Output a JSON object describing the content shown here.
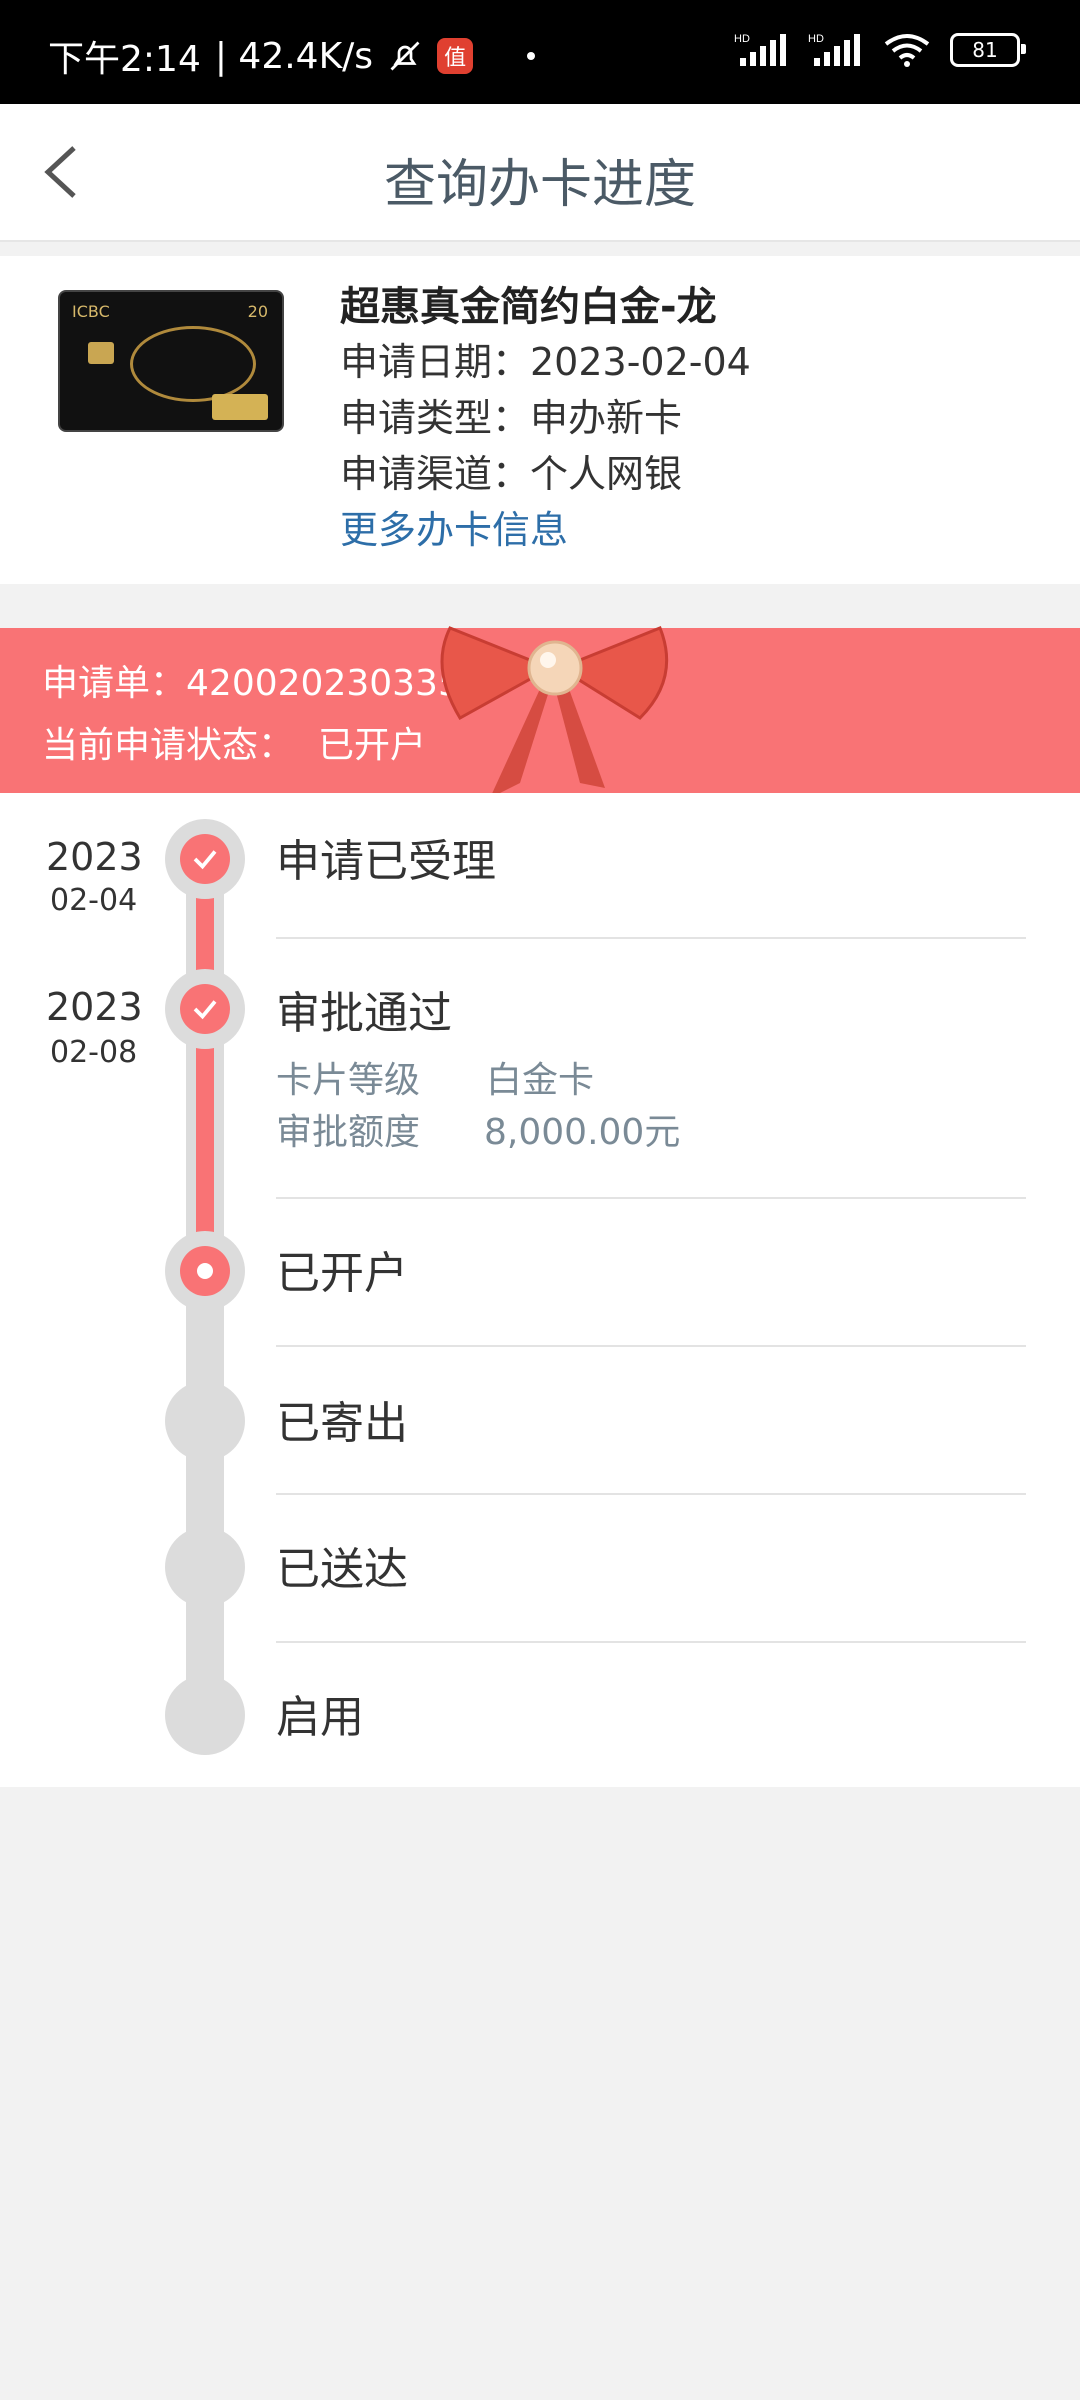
{
  "status_bar": {
    "time": "下午2:14",
    "speed": "| 42.4K/s",
    "app_badge": "值",
    "signal1": "HD",
    "signal2": "HD",
    "battery": "81"
  },
  "header": {
    "title": "查询办卡进度"
  },
  "card": {
    "image_brand": "ICBC",
    "image_mark": "20",
    "name": "超惠真金简约白金-龙",
    "apply_date": "申请日期：2023-02-04",
    "apply_type": "申请类型：申办新卡",
    "apply_channel": "申请渠道：个人网银",
    "more_link": "更多办卡信息"
  },
  "banner": {
    "order_label": "申请单：",
    "order_no": "4200202303357",
    "status_label": "当前申请状态：",
    "status_value": "已开户"
  },
  "timeline": {
    "steps": [
      {
        "year": "2023",
        "md": "02-04",
        "label": "申请已受理",
        "state": "done"
      },
      {
        "year": "2023",
        "md": "02-08",
        "label": "审批通过",
        "state": "done",
        "details": [
          {
            "key": "卡片等级",
            "value": "白金卡"
          },
          {
            "key": "审批额度",
            "value": "8,000.00元"
          }
        ]
      },
      {
        "label": "已开户",
        "state": "current"
      },
      {
        "label": "已寄出",
        "state": "pending"
      },
      {
        "label": "已送达",
        "state": "pending"
      },
      {
        "label": "启用",
        "state": "pending"
      }
    ]
  },
  "colors": {
    "accent": "#f97375",
    "link": "#2d6ea8",
    "track": "#dcdcdc"
  }
}
